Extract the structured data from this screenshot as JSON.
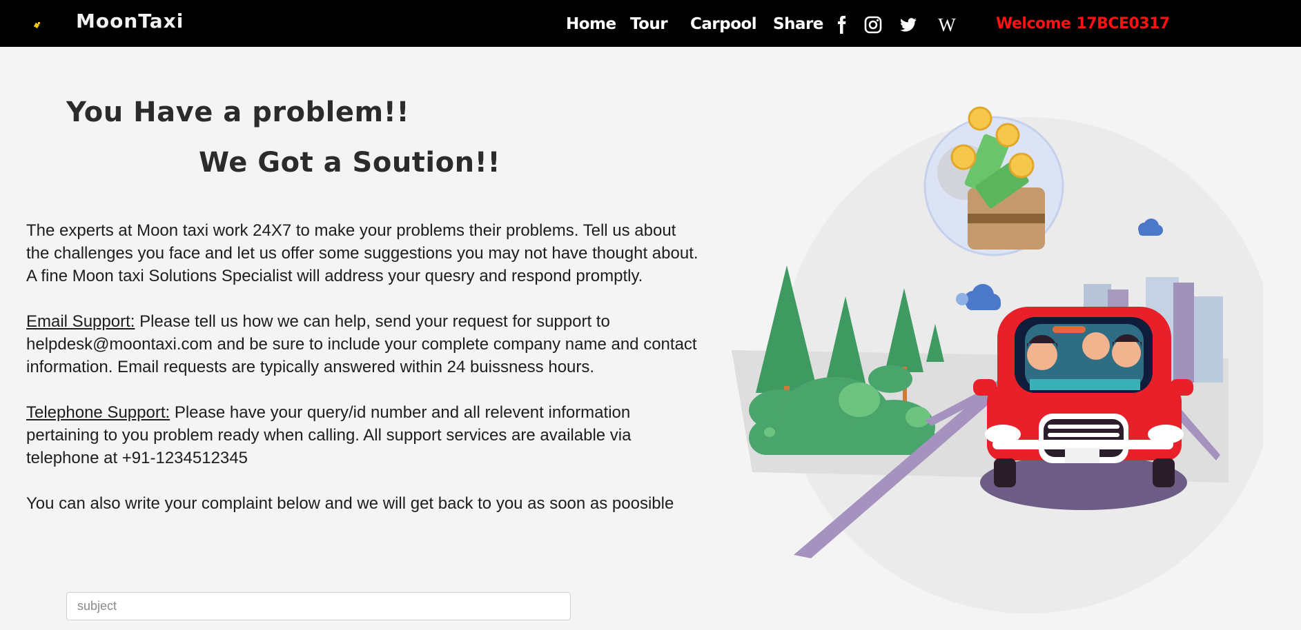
{
  "navbar": {
    "brand": "MoonTaxi",
    "links": [
      "Home",
      "Tour",
      "Carpool",
      "Share"
    ],
    "icons": [
      "facebook-icon",
      "instagram-icon",
      "twitter-icon",
      "wikipedia-icon"
    ],
    "welcome_label": "Welcome",
    "user_id": "17BCE0317"
  },
  "hero": {
    "headline1": "You Have a problem!!",
    "headline2": "We Got a Soution!!"
  },
  "content": {
    "intro": "The experts at Moon taxi work 24X7 to make your problems their problems. Tell us about the challenges you face and let us offer some suggestions you may not have thought about. A fine Moon taxi Solutions Specialist will address your quesry and respond promptly.",
    "email_label": "Email Support:",
    "email_text": " Please tell us how we can help, send your request for support to helpdesk@moontaxi.com and be sure to include your complete company name and contact information. Email requests are typically answered within 24 buissness hours.",
    "phone_label": "Telephone Support:",
    "phone_text": " Please have your query/id number and all relevent information pertaining to you problem ready when calling. All support services are available via telephone at +91-1234512345",
    "complaint": "You can also write your complaint below and we will get back to you as soon as poosible"
  },
  "form": {
    "subject_placeholder": "subject",
    "subject_value": ""
  },
  "colors": {
    "navbar_bg": "#000000",
    "welcome": "#ff1111",
    "page_bg": "#f4f4f4",
    "car_red": "#e8202a"
  }
}
